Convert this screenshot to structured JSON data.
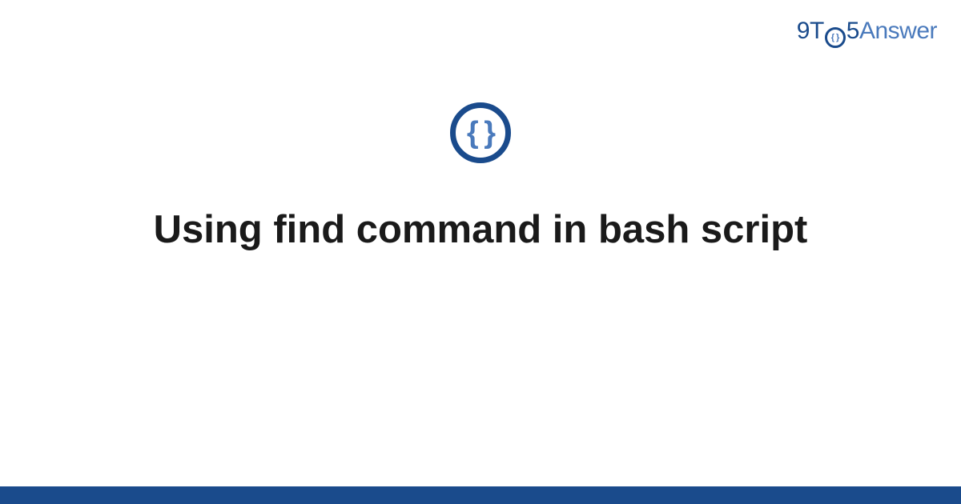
{
  "brand": {
    "nine": "9",
    "t": "T",
    "circle_text": "{ }",
    "five": "5",
    "answer": "Answer"
  },
  "icon": {
    "braces": "{ }",
    "semantic_name": "code-braces-icon"
  },
  "title": "Using find command in bash script",
  "colors": {
    "primary": "#1a4b8c",
    "secondary": "#4a7abc",
    "text": "#1a1a1a",
    "background": "#ffffff"
  }
}
